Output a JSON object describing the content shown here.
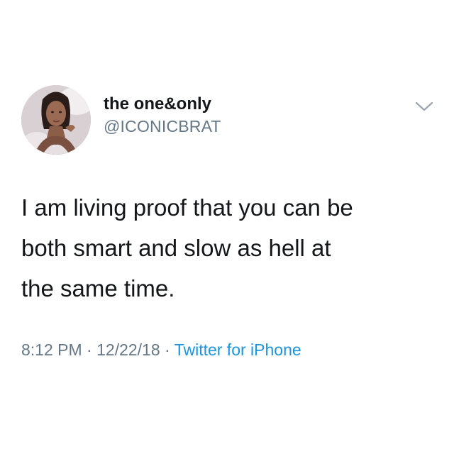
{
  "tweet": {
    "author": {
      "display_name": "the one&only",
      "handle": "@ICONICBRAT",
      "avatar_icon": "profile-photo"
    },
    "menu_icon": "chevron-down-icon",
    "text_lines": [
      "I am living proof that you can be",
      "both smart and slow as hell at",
      "the same time."
    ],
    "meta": {
      "time": "8:12 PM",
      "separator": "·",
      "date": "12/22/18",
      "source": "Twitter for iPhone"
    }
  },
  "colors": {
    "text_primary": "#14171a",
    "text_secondary": "#657786",
    "link": "#1b95e0",
    "chevron": "#9aa5ae"
  }
}
